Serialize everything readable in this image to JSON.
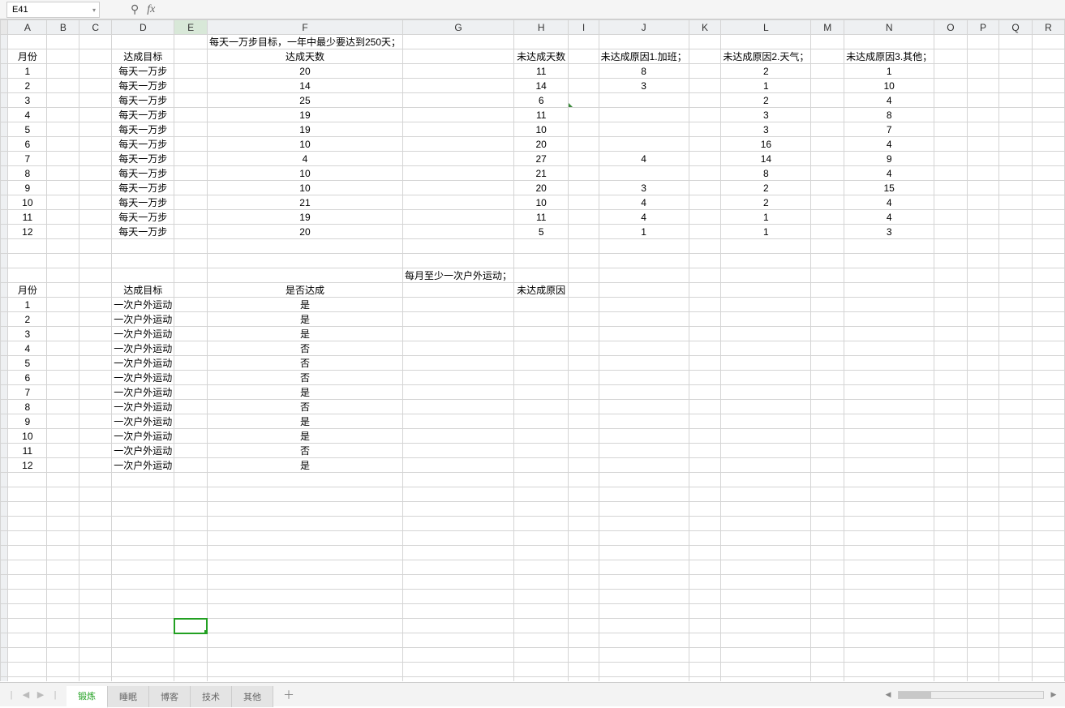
{
  "name_box": "E41",
  "formula": "",
  "columns": [
    "A",
    "B",
    "C",
    "D",
    "E",
    "F",
    "G",
    "H",
    "I",
    "J",
    "K",
    "L",
    "M",
    "N",
    "O",
    "P",
    "Q",
    "R"
  ],
  "selected_col_index": 4,
  "selected_cell": {
    "row": 41,
    "col": 4
  },
  "titles": {
    "t1": "每天一万步目标，一年中最少要达到250天；",
    "t2": "每月至少一次户外运动；"
  },
  "headers1": {
    "month": "月份",
    "goal": "达成目标",
    "days_ok": "达成天数",
    "days_no": "未达成天数",
    "reason1": "未达成原因1.加班；",
    "reason2": "未达成原因2.天气；",
    "reason3": "未达成原因3.其他；"
  },
  "data1": [
    {
      "m": 1,
      "g": "每天一万步",
      "ok": 20,
      "no": 11,
      "r1": 8,
      "r2": 2,
      "r3": 1
    },
    {
      "m": 2,
      "g": "每天一万步",
      "ok": 14,
      "no": 14,
      "r1": 3,
      "r2": 1,
      "r3": 10
    },
    {
      "m": 3,
      "g": "每天一万步",
      "ok": 25,
      "no": 6,
      "r1": "",
      "r2": 2,
      "r3": 4
    },
    {
      "m": 4,
      "g": "每天一万步",
      "ok": 19,
      "no": 11,
      "r1": "",
      "r2": 3,
      "r3": 8
    },
    {
      "m": 5,
      "g": "每天一万步",
      "ok": 19,
      "no": 10,
      "r1": "",
      "r2": 3,
      "r3": 7
    },
    {
      "m": 6,
      "g": "每天一万步",
      "ok": 10,
      "no": 20,
      "r1": "",
      "r2": 16,
      "r3": 4
    },
    {
      "m": 7,
      "g": "每天一万步",
      "ok": 4,
      "no": 27,
      "r1": 4,
      "r2": 14,
      "r3": 9
    },
    {
      "m": 8,
      "g": "每天一万步",
      "ok": 10,
      "no": 21,
      "r1": "",
      "r2": 8,
      "r3": 4
    },
    {
      "m": 9,
      "g": "每天一万步",
      "ok": 10,
      "no": 20,
      "r1": 3,
      "r2": 2,
      "r3": 15
    },
    {
      "m": 10,
      "g": "每天一万步",
      "ok": 21,
      "no": 10,
      "r1": 4,
      "r2": 2,
      "r3": 4
    },
    {
      "m": 11,
      "g": "每天一万步",
      "ok": 19,
      "no": 11,
      "r1": 4,
      "r2": 1,
      "r3": 4
    },
    {
      "m": 12,
      "g": "每天一万步",
      "ok": 20,
      "no": 5,
      "r1": 1,
      "r2": 1,
      "r3": 3
    }
  ],
  "headers2": {
    "month": "月份",
    "goal": "达成目标",
    "achieved": "是否达成",
    "reason": "未达成原因"
  },
  "data2": [
    {
      "m": 1,
      "g": "一次户外运动",
      "a": "是"
    },
    {
      "m": 2,
      "g": "一次户外运动",
      "a": "是"
    },
    {
      "m": 3,
      "g": "一次户外运动",
      "a": "是"
    },
    {
      "m": 4,
      "g": "一次户外运动",
      "a": "否"
    },
    {
      "m": 5,
      "g": "一次户外运动",
      "a": "否"
    },
    {
      "m": 6,
      "g": "一次户外运动",
      "a": "否"
    },
    {
      "m": 7,
      "g": "一次户外运动",
      "a": "是"
    },
    {
      "m": 8,
      "g": "一次户外运动",
      "a": "否"
    },
    {
      "m": 9,
      "g": "一次户外运动",
      "a": "是"
    },
    {
      "m": 10,
      "g": "一次户外运动",
      "a": "是"
    },
    {
      "m": 11,
      "g": "一次户外运动",
      "a": "否"
    },
    {
      "m": 12,
      "g": "一次户外运动",
      "a": "是"
    }
  ],
  "tabs": [
    "锻炼",
    "睡眠",
    "博客",
    "技术",
    "其他"
  ],
  "active_tab": 0,
  "glyphs": {
    "zoom": "⚲",
    "add": "＋",
    "left": "◀",
    "right": "▶",
    "bar": "|"
  }
}
